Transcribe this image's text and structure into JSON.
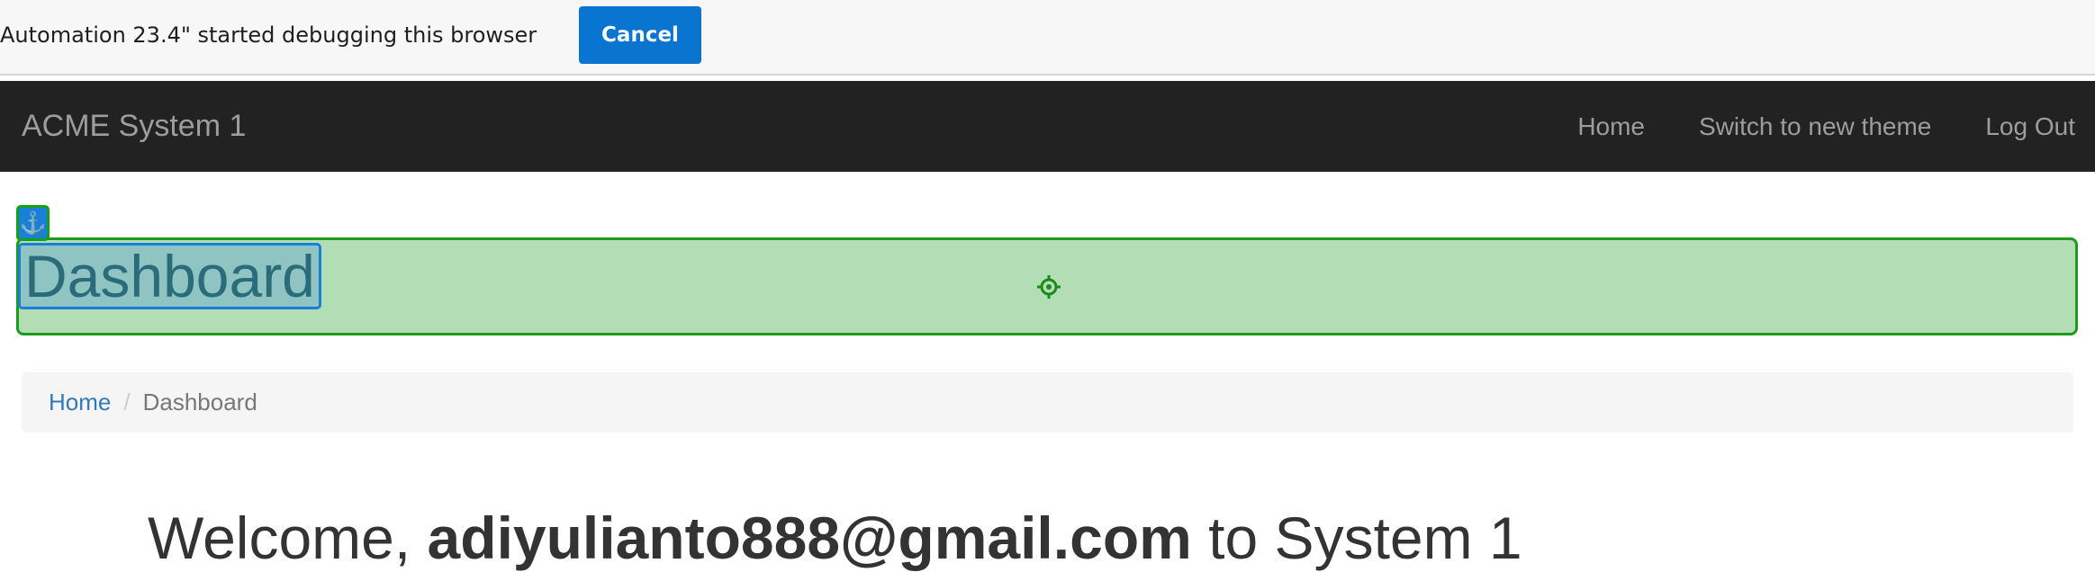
{
  "infobar": {
    "message": "Automation 23.4\" started debugging this browser",
    "cancel_label": "Cancel"
  },
  "navbar": {
    "brand": "ACME System 1",
    "links": [
      "Home",
      "Switch to new theme",
      "Log Out"
    ]
  },
  "page": {
    "heading": "Dashboard",
    "anchor_icon": "anchor-icon",
    "target_icon": "crosshair-icon"
  },
  "breadcrumb": {
    "home": "Home",
    "separator": "/",
    "current": "Dashboard"
  },
  "welcome": {
    "prefix": "Welcome, ",
    "user": "adiyulianto888@gmail.com",
    "suffix": " to System 1"
  },
  "colors": {
    "navbar_bg": "#222222",
    "cancel_bg": "#0a74d1",
    "highlight_fill": "#b3deb5",
    "highlight_border": "#1e9a1e",
    "link": "#337ab7"
  }
}
